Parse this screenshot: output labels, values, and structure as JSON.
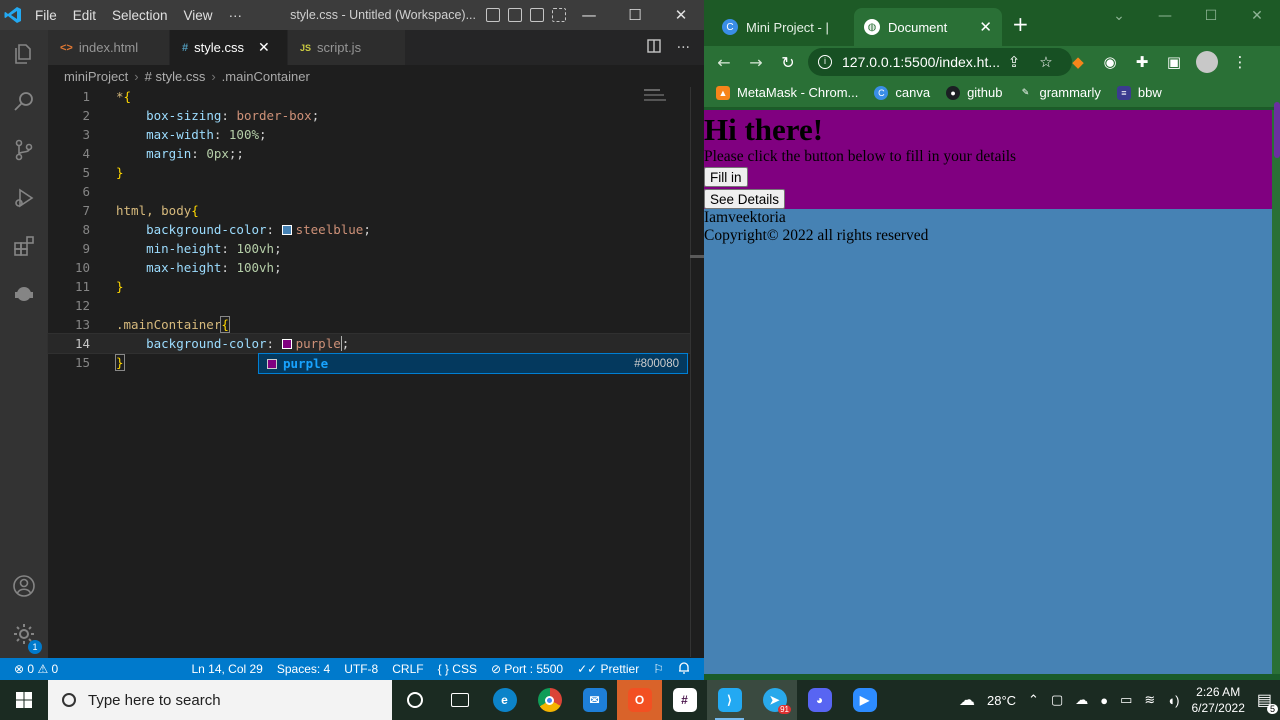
{
  "vscode": {
    "menu": [
      "File",
      "Edit",
      "Selection",
      "View",
      "···"
    ],
    "window_title": "style.css - Untitled (Workspace)...",
    "window_controls": [
      "—",
      "☐",
      "✕"
    ],
    "tabs": [
      {
        "icon": "<>",
        "label": "index.html",
        "active": false
      },
      {
        "icon": "#",
        "label": "style.css",
        "active": true
      },
      {
        "icon": "JS",
        "label": "script.js",
        "active": false
      }
    ],
    "breadcrumb": [
      "miniProject",
      "# style.css",
      ".mainContainer"
    ],
    "code_lines": [
      {
        "n": "1"
      },
      {
        "n": "2"
      },
      {
        "n": "3"
      },
      {
        "n": "4"
      },
      {
        "n": "5"
      },
      {
        "n": "6"
      },
      {
        "n": "7"
      },
      {
        "n": "8"
      },
      {
        "n": "9"
      },
      {
        "n": "10"
      },
      {
        "n": "11"
      },
      {
        "n": "12"
      },
      {
        "n": "13"
      },
      {
        "n": "14"
      },
      {
        "n": "15"
      }
    ],
    "code": {
      "l1_sel": "*",
      "l1_brace": "{",
      "l2_prop": "box-sizing",
      "l2_val": "border-box",
      "l3_prop": "max-width",
      "l3_val": "100%",
      "l4_prop": "margin",
      "l4_val": "0px",
      "l5_brace": "}",
      "l7_sel": "html, body",
      "l7_brace": "{",
      "l8_prop": "background-color",
      "l8_val": "steelblue",
      "l9_prop": "min-height",
      "l9_val": "100vh",
      "l10_prop": "max-height",
      "l10_val": "100vh",
      "l11_brace": "}",
      "l13_sel": ".mainContainer",
      "l13_brace": "{",
      "l14_prop": "background-color",
      "l14_val": "purple",
      "l15_brace": "}"
    },
    "suggestion": {
      "label": "purple",
      "detail": "#800080",
      "swatch_color": "#800080"
    },
    "status": {
      "errors": "0",
      "warnings": "0",
      "position": "Ln 14, Col 29",
      "spaces": "Spaces: 4",
      "encoding": "UTF-8",
      "eol": "CRLF",
      "language": "CSS",
      "port": "Port : 5500",
      "formatter": "Prettier"
    },
    "settings_badge": "1"
  },
  "chrome": {
    "tabs": [
      {
        "label": "Mini Project - |",
        "active": false
      },
      {
        "label": "Document",
        "active": true
      }
    ],
    "url": "127.0.0.1:5500/index.ht...",
    "bookmarks": [
      "MetaMask - Chrom...",
      "canva",
      "github",
      "grammarly",
      "bbw"
    ],
    "page": {
      "heading": "Hi there!",
      "subtitle": "Please click the button below to fill in your details",
      "button_fill": "Fill in",
      "button_details": "See Details",
      "author": "Iamveektoria",
      "copyright": "Copyright© 2022 all rights reserved"
    }
  },
  "taskbar": {
    "search_placeholder": "Type here to search",
    "weather": "28°C",
    "time": "2:26 AM",
    "date": "6/27/2022",
    "notification_count": "5",
    "telegram_badge": "91"
  },
  "colors": {
    "vscode_accent": "#007acc",
    "chrome_theme": "#2a7036",
    "page_background": "#4682b4",
    "main_container": "#800080"
  }
}
